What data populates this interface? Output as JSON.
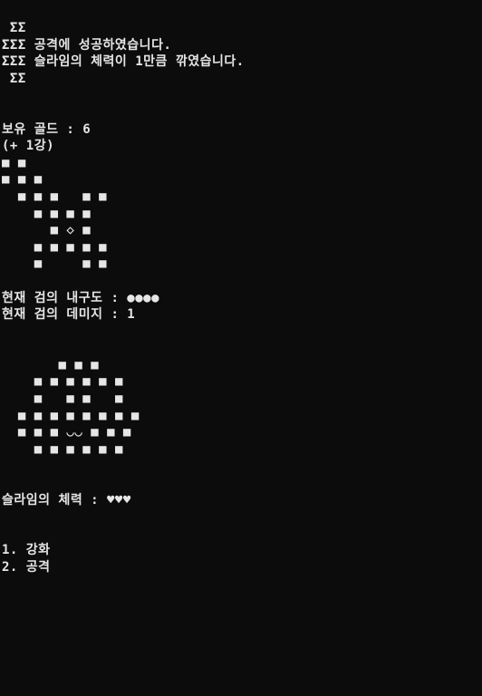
{
  "console": {
    "message_lines": [
      " ΣΣ",
      "ΣΣΣ 공격에 성공하였습니다.",
      "ΣΣΣ 슬라임의 체력이 1만큼 깎였습니다.",
      " ΣΣ"
    ],
    "gold_line": "보유 골드 : 6",
    "enhance_line": "(+ 1강)",
    "sword_art": [
      "■ ■",
      "■ ■ ■",
      "  ■ ■ ■   ■ ■",
      "    ■ ■ ■ ■",
      "      ■ ◇ ■",
      "    ■ ■ ■ ■ ■",
      "    ■     ■ ■"
    ],
    "durability_line": "현재 검의 내구도 : ●●●●",
    "damage_line": "현재 검의 데미지 : 1",
    "slime_art": [
      "       ■ ■ ■",
      "    ■ ■ ■ ■ ■ ■",
      "    ■   ■ ■   ■",
      "  ■ ■ ■ ■ ■ ■ ■ ■",
      "  ■ ■ ■ ◡◡ ■ ■ ■",
      "    ■ ■ ■ ■ ■ ■"
    ],
    "slime_hp_line": "슬라임의 체력 : ♥♥♥",
    "menu": [
      "1. 강화",
      "2. 공격"
    ]
  }
}
